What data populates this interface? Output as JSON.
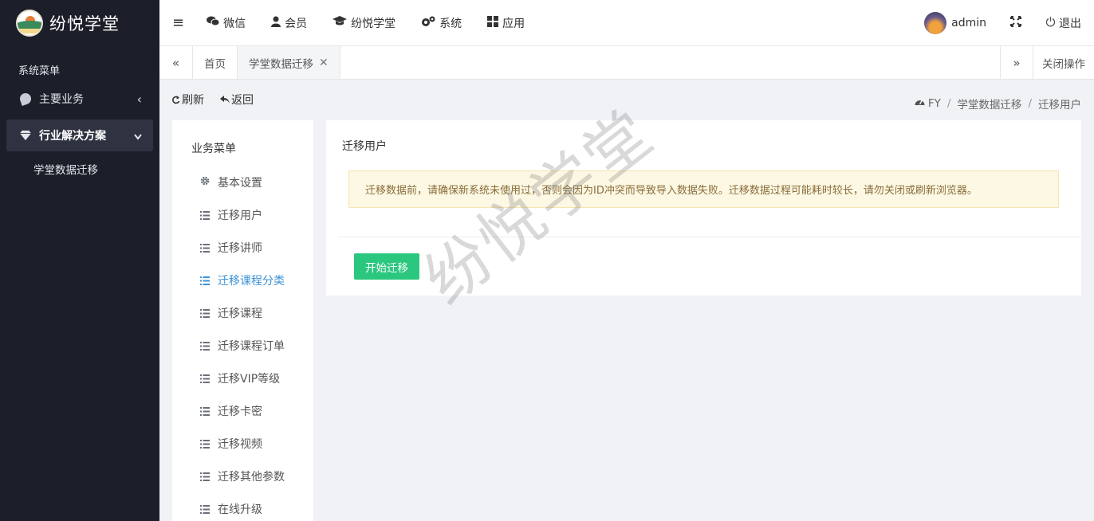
{
  "app": {
    "title": "纷悦学堂"
  },
  "sidebar": {
    "section_label": "系统菜单",
    "items": [
      {
        "label": "主要业务",
        "icon": "leaf-icon",
        "arrow": "‹"
      },
      {
        "label": "行业解决方案",
        "icon": "diamond-icon",
        "arrow": "⌄"
      }
    ],
    "sub_items": [
      {
        "label": "学堂数据迁移"
      }
    ]
  },
  "topbar": {
    "menu_icon": "≡",
    "items": [
      {
        "label": "微信",
        "icon": "wechat-icon"
      },
      {
        "label": "会员",
        "icon": "user-icon"
      },
      {
        "label": "纷悦学堂",
        "icon": "graduation-cap-icon"
      },
      {
        "label": "系统",
        "icon": "gears-icon"
      },
      {
        "label": "应用",
        "icon": "grid-icon"
      }
    ],
    "username": "admin",
    "logout_label": "退出"
  },
  "tabs": {
    "items": [
      {
        "label": "首页"
      },
      {
        "label": "学堂数据迁移",
        "closable": true
      }
    ],
    "close_ops_label": "关闭操作"
  },
  "toolbar": {
    "refresh_label": "刷新",
    "back_label": "返回"
  },
  "breadcrumb": {
    "items": [
      "FY",
      "学堂数据迁移",
      "迁移用户"
    ]
  },
  "bizmenu": {
    "title": "业务菜单",
    "items": [
      {
        "label": "基本设置",
        "icon": "gear-icon"
      },
      {
        "label": "迁移用户",
        "icon": "list-icon"
      },
      {
        "label": "迁移讲师",
        "icon": "list-icon"
      },
      {
        "label": "迁移课程分类",
        "icon": "list-icon",
        "active": true
      },
      {
        "label": "迁移课程",
        "icon": "list-icon"
      },
      {
        "label": "迁移课程订单",
        "icon": "list-icon"
      },
      {
        "label": "迁移VIP等级",
        "icon": "list-icon"
      },
      {
        "label": "迁移卡密",
        "icon": "list-icon"
      },
      {
        "label": "迁移视频",
        "icon": "list-icon"
      },
      {
        "label": "迁移其他参数",
        "icon": "list-icon"
      },
      {
        "label": "在线升级",
        "icon": "list-icon"
      }
    ]
  },
  "panel": {
    "title": "迁移用户",
    "alert": "迁移数据前，请确保新系统未使用过，否则会因为ID冲突而导致导入数据失败。迁移数据过程可能耗时较长，请勿关闭或刷新浏览器。",
    "start_button": "开始迁移"
  },
  "watermark": "纷悦学堂",
  "colors": {
    "sidebar_bg": "#1c1e29",
    "active_link": "#3a91d6",
    "primary_button": "#2bc77f",
    "alert_bg": "#fcf8e3"
  }
}
